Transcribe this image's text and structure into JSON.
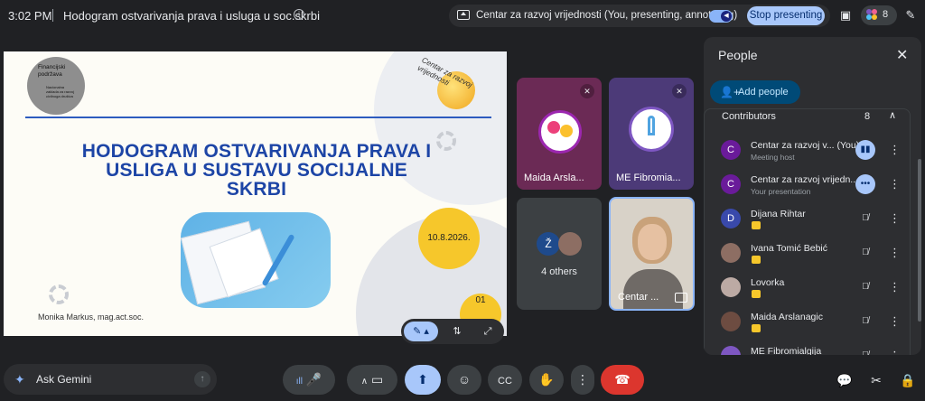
{
  "topbar": {
    "time": "3:02 PM",
    "meeting_title": "Hodogram ostvarivanja prava i usluga u soc.skrbi",
    "presenting_text": "Centar za razvoj vrijednosti (You, presenting, annotating)",
    "stop_presenting_label": "Stop presenting",
    "participant_count": "8"
  },
  "slide": {
    "logo_text": "Financijski podržava",
    "logo_subtext": "Nacionalna zaklada za razvoj civilnoga društva",
    "brand_text": "Centar za razvoj vrijednosti",
    "title": "HODOGRAM OSTVARIVANJA PRAVA I USLIGA U SUSTAVU SOCIJALNE SKRBI",
    "date": "10.8.2026.",
    "page_number": "01",
    "author": "Monika Markus, mag.act.soc."
  },
  "tiles": {
    "maida": "Maida Arsla...",
    "me": "ME Fibromia...",
    "others": "4 others",
    "others_initial": "Ž",
    "centar": "Centar ..."
  },
  "people_panel": {
    "header": "People",
    "add_people_label": "Add people",
    "section_title": "Contributors",
    "section_count": "8",
    "people": [
      {
        "initial": "C",
        "name": "Centar za razvoj v...",
        "you": "(You)",
        "sub": "Meeting host",
        "avatar_color": "#6a1b9a"
      },
      {
        "initial": "C",
        "name": "Centar za razvoj vrijedn...",
        "sub": "Your presentation",
        "avatar_color": "#6a1b9a"
      },
      {
        "initial": "D",
        "name": "Dijana Rihtar",
        "sub": "",
        "avatar_color": "#3949ab"
      },
      {
        "initial": "",
        "name": "Ivana Tomić Bebić",
        "sub": "",
        "avatar_color": "#8d6e63"
      },
      {
        "initial": "",
        "name": "Lovorka",
        "sub": "",
        "avatar_color": "#bcaaa4"
      },
      {
        "initial": "",
        "name": "Maida Arslanagic",
        "sub": "",
        "avatar_color": "#6d4c41"
      },
      {
        "initial": "",
        "name": "ME Fibromialgija",
        "sub": "",
        "avatar_color": "#7e57c2"
      }
    ]
  },
  "bottombar": {
    "gemini_label": "Ask Gemini"
  },
  "colors": {
    "accent": "#a8c7fa",
    "end_call": "#dc362e",
    "slide_title": "#1d45a6",
    "yellow": "#f6c72b"
  }
}
